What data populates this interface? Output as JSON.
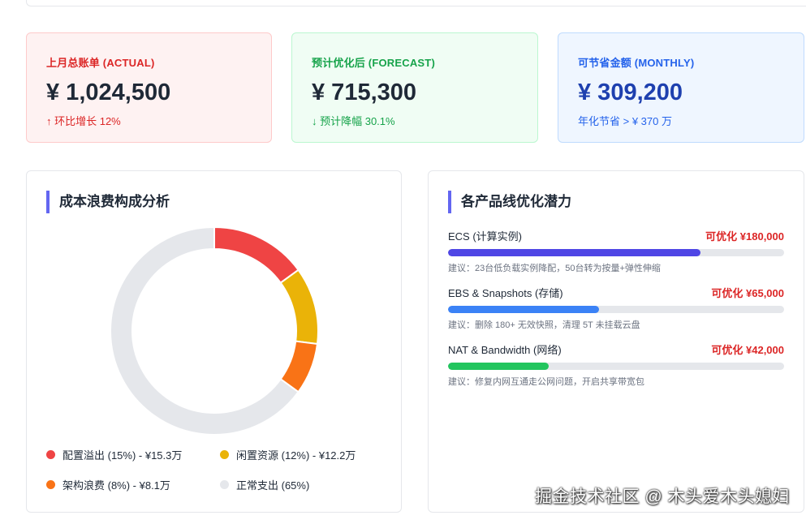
{
  "kpis": [
    {
      "label": "上月总账单 (ACTUAL)",
      "value": "¥ 1,024,500",
      "sub": "↑ 环比增长 12%"
    },
    {
      "label": "预计优化后 (FORECAST)",
      "value": "¥ 715,300",
      "sub": "↓ 预计降幅 30.1%"
    },
    {
      "label": "可节省金额 (MONTHLY)",
      "value": "¥ 309,200",
      "sub": "年化节省 > ¥ 370 万"
    }
  ],
  "waste": {
    "title": "成本浪费构成分析",
    "chart_data": {
      "type": "pie",
      "donut": true,
      "slices": [
        {
          "label": "配置溢出 (15%) - ¥15.3万",
          "value": 15,
          "color": "#ef4444"
        },
        {
          "label": "闲置资源 (12%) - ¥12.2万",
          "value": 12,
          "color": "#eab308"
        },
        {
          "label": "架构浪费 (8%) - ¥8.1万",
          "value": 8,
          "color": "#f97316"
        },
        {
          "label": "正常支出 (65%)",
          "value": 65,
          "color": "#e5e7eb"
        }
      ]
    }
  },
  "products": {
    "title": "各产品线优化潜力",
    "items": [
      {
        "name": "ECS (计算实例)",
        "potential": "可优化 ¥180,000",
        "progress": 0.75,
        "color": "#4f46e5",
        "tip": "建议：23台低负载实例降配，50台转为按量+弹性伸缩"
      },
      {
        "name": "EBS & Snapshots (存储)",
        "potential": "可优化 ¥65,000",
        "progress": 0.45,
        "color": "#3b82f6",
        "tip": "建议：删除 180+ 无效快照，清理 5T 未挂载云盘"
      },
      {
        "name": "NAT & Bandwidth (网络)",
        "potential": "可优化 ¥42,000",
        "progress": 0.3,
        "color": "#22c55e",
        "tip": "建议：修复内网互通走公网问题，开启共享带宽包"
      }
    ]
  },
  "watermark": "掘金技术社区 @ 木头爱木头媳妇"
}
